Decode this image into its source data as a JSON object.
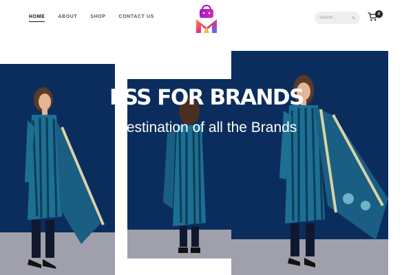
{
  "nav": {
    "items": [
      {
        "label": "HOME",
        "active": true
      },
      {
        "label": "ABOUT",
        "active": false
      },
      {
        "label": "SHOP",
        "active": false
      },
      {
        "label": "CONTACT US",
        "active": false
      }
    ]
  },
  "logo": {
    "icon": "shopping-bag-logo-icon",
    "colors": [
      "#c724b1",
      "#ff6a3d",
      "#3a7bff"
    ]
  },
  "search": {
    "placeholder": "Search ...",
    "icon": "search-icon"
  },
  "cart": {
    "icon": "cart-icon",
    "count": "0"
  },
  "hero": {
    "title": "ESS FOR BRANDS",
    "subtitle": "Destination of all the Brands",
    "colors": {
      "backdrop": "#0b2d5e",
      "dress": "#1d6f94",
      "floor": "#9fa0ab"
    }
  }
}
